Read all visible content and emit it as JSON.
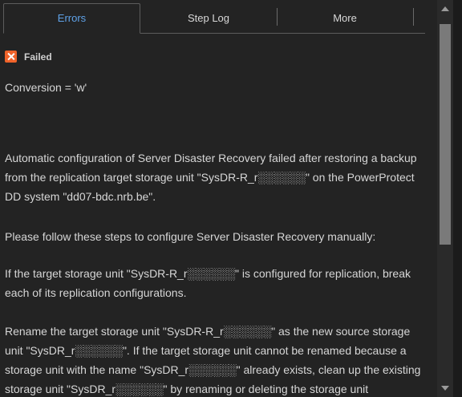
{
  "tabs": {
    "errors": "Errors",
    "step_log": "Step Log",
    "more": "More"
  },
  "status": {
    "icon": "error-x-icon",
    "label": "Failed"
  },
  "message": {
    "conversion": "Conversion = 'w'",
    "automatic_config": "Automatic configuration of Server Disaster Recovery failed after restoring a backup from the replication target storage unit \"SysDR-R_r░░░░░░\" on the PowerProtect DD system \"dd07-bdc.nrb.be\".",
    "follow_steps": "Please follow these steps to configure Server Disaster Recovery manually:",
    "break_replication": "If the target storage unit \"SysDR-R_r░░░░░░\" is configured for replication, break each of its replication configurations.",
    "rename_unit": "Rename the target storage unit \"SysDR-R_r░░░░░░\" as the new source storage unit \"SysDR_r░░░░░░\". If the target storage unit cannot be renamed because a storage unit with the name \"SysDR_r░░░░░░\" already exists, clean up the existing storage unit \"SysDR_r░░░░░░\" by renaming or deleting the storage unit"
  },
  "colors": {
    "background": "#232323",
    "active_tab_text": "#5fa2e8",
    "text": "#d6d6d6",
    "error": "#f0632a"
  }
}
